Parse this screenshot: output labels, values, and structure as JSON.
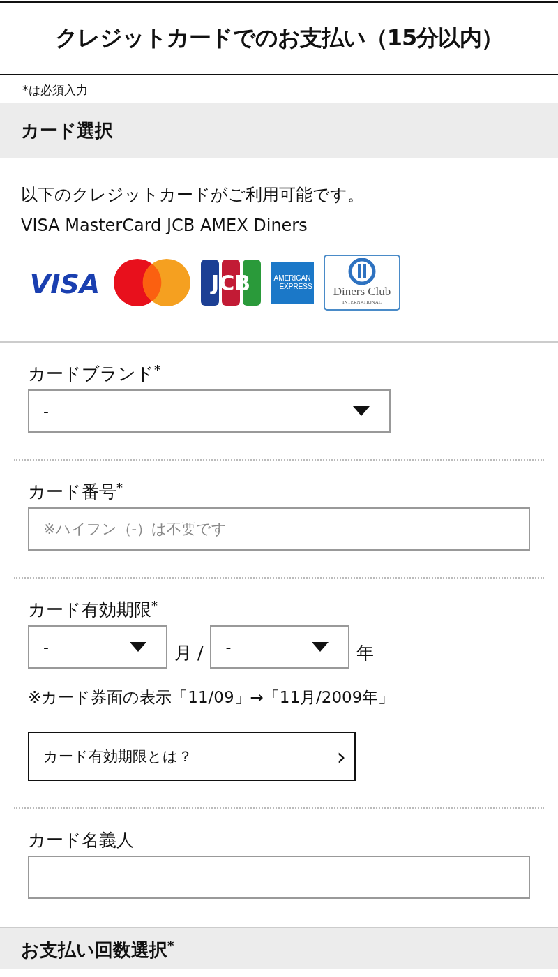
{
  "header": {
    "title": "クレジットカードでのお支払い（15分以内）"
  },
  "required_note": "*は必須入力",
  "card_section": {
    "heading": "カード選択",
    "description": [
      "以下のクレジットカードがご利用可能です。",
      "VISA MasterCard JCB AMEX Diners"
    ],
    "logos": [
      {
        "kind": "visa",
        "texts": [
          "VISA"
        ]
      },
      {
        "kind": "mastercard"
      },
      {
        "kind": "jcb",
        "texts": [
          "JCB"
        ]
      },
      {
        "kind": "amex",
        "texts": [
          "AMERICAN",
          "EXPRESS"
        ]
      },
      {
        "kind": "diners",
        "texts": [
          "Diners Club",
          "INTERNATIONAL"
        ]
      }
    ]
  },
  "fields": [
    {
      "kind": "select",
      "label": "カードブランド",
      "required_mark": "*",
      "value": "-"
    },
    {
      "kind": "text",
      "label": "カード番号",
      "required_mark": "*",
      "placeholder": "※ハイフン（-）は不要です"
    },
    {
      "kind": "expiry",
      "label": "カード有効期限",
      "required_mark": "*",
      "month": "-",
      "month_unit": "月 /",
      "year": "-",
      "year_unit": "年",
      "note": "※カード券面の表示「11/09」→「11月/2009年」",
      "help_button": "カード有効期限とは？",
      "help_chevron": "›"
    },
    {
      "kind": "text",
      "label": "カード名義人"
    }
  ],
  "next_section": {
    "heading": "お支払い回数選択",
    "required_mark": "*"
  }
}
